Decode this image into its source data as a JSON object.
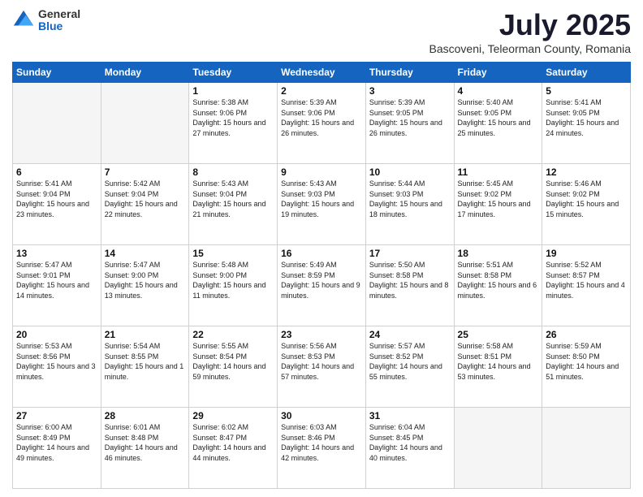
{
  "logo": {
    "general": "General",
    "blue": "Blue"
  },
  "title": "July 2025",
  "subtitle": "Bascoveni, Teleorman County, Romania",
  "weekdays": [
    "Sunday",
    "Monday",
    "Tuesday",
    "Wednesday",
    "Thursday",
    "Friday",
    "Saturday"
  ],
  "weeks": [
    [
      {
        "day": "",
        "sunrise": "",
        "sunset": "",
        "daylight": ""
      },
      {
        "day": "",
        "sunrise": "",
        "sunset": "",
        "daylight": ""
      },
      {
        "day": "1",
        "sunrise": "Sunrise: 5:38 AM",
        "sunset": "Sunset: 9:06 PM",
        "daylight": "Daylight: 15 hours and 27 minutes."
      },
      {
        "day": "2",
        "sunrise": "Sunrise: 5:39 AM",
        "sunset": "Sunset: 9:06 PM",
        "daylight": "Daylight: 15 hours and 26 minutes."
      },
      {
        "day": "3",
        "sunrise": "Sunrise: 5:39 AM",
        "sunset": "Sunset: 9:05 PM",
        "daylight": "Daylight: 15 hours and 26 minutes."
      },
      {
        "day": "4",
        "sunrise": "Sunrise: 5:40 AM",
        "sunset": "Sunset: 9:05 PM",
        "daylight": "Daylight: 15 hours and 25 minutes."
      },
      {
        "day": "5",
        "sunrise": "Sunrise: 5:41 AM",
        "sunset": "Sunset: 9:05 PM",
        "daylight": "Daylight: 15 hours and 24 minutes."
      }
    ],
    [
      {
        "day": "6",
        "sunrise": "Sunrise: 5:41 AM",
        "sunset": "Sunset: 9:04 PM",
        "daylight": "Daylight: 15 hours and 23 minutes."
      },
      {
        "day": "7",
        "sunrise": "Sunrise: 5:42 AM",
        "sunset": "Sunset: 9:04 PM",
        "daylight": "Daylight: 15 hours and 22 minutes."
      },
      {
        "day": "8",
        "sunrise": "Sunrise: 5:43 AM",
        "sunset": "Sunset: 9:04 PM",
        "daylight": "Daylight: 15 hours and 21 minutes."
      },
      {
        "day": "9",
        "sunrise": "Sunrise: 5:43 AM",
        "sunset": "Sunset: 9:03 PM",
        "daylight": "Daylight: 15 hours and 19 minutes."
      },
      {
        "day": "10",
        "sunrise": "Sunrise: 5:44 AM",
        "sunset": "Sunset: 9:03 PM",
        "daylight": "Daylight: 15 hours and 18 minutes."
      },
      {
        "day": "11",
        "sunrise": "Sunrise: 5:45 AM",
        "sunset": "Sunset: 9:02 PM",
        "daylight": "Daylight: 15 hours and 17 minutes."
      },
      {
        "day": "12",
        "sunrise": "Sunrise: 5:46 AM",
        "sunset": "Sunset: 9:02 PM",
        "daylight": "Daylight: 15 hours and 15 minutes."
      }
    ],
    [
      {
        "day": "13",
        "sunrise": "Sunrise: 5:47 AM",
        "sunset": "Sunset: 9:01 PM",
        "daylight": "Daylight: 15 hours and 14 minutes."
      },
      {
        "day": "14",
        "sunrise": "Sunrise: 5:47 AM",
        "sunset": "Sunset: 9:00 PM",
        "daylight": "Daylight: 15 hours and 13 minutes."
      },
      {
        "day": "15",
        "sunrise": "Sunrise: 5:48 AM",
        "sunset": "Sunset: 9:00 PM",
        "daylight": "Daylight: 15 hours and 11 minutes."
      },
      {
        "day": "16",
        "sunrise": "Sunrise: 5:49 AM",
        "sunset": "Sunset: 8:59 PM",
        "daylight": "Daylight: 15 hours and 9 minutes."
      },
      {
        "day": "17",
        "sunrise": "Sunrise: 5:50 AM",
        "sunset": "Sunset: 8:58 PM",
        "daylight": "Daylight: 15 hours and 8 minutes."
      },
      {
        "day": "18",
        "sunrise": "Sunrise: 5:51 AM",
        "sunset": "Sunset: 8:58 PM",
        "daylight": "Daylight: 15 hours and 6 minutes."
      },
      {
        "day": "19",
        "sunrise": "Sunrise: 5:52 AM",
        "sunset": "Sunset: 8:57 PM",
        "daylight": "Daylight: 15 hours and 4 minutes."
      }
    ],
    [
      {
        "day": "20",
        "sunrise": "Sunrise: 5:53 AM",
        "sunset": "Sunset: 8:56 PM",
        "daylight": "Daylight: 15 hours and 3 minutes."
      },
      {
        "day": "21",
        "sunrise": "Sunrise: 5:54 AM",
        "sunset": "Sunset: 8:55 PM",
        "daylight": "Daylight: 15 hours and 1 minute."
      },
      {
        "day": "22",
        "sunrise": "Sunrise: 5:55 AM",
        "sunset": "Sunset: 8:54 PM",
        "daylight": "Daylight: 14 hours and 59 minutes."
      },
      {
        "day": "23",
        "sunrise": "Sunrise: 5:56 AM",
        "sunset": "Sunset: 8:53 PM",
        "daylight": "Daylight: 14 hours and 57 minutes."
      },
      {
        "day": "24",
        "sunrise": "Sunrise: 5:57 AM",
        "sunset": "Sunset: 8:52 PM",
        "daylight": "Daylight: 14 hours and 55 minutes."
      },
      {
        "day": "25",
        "sunrise": "Sunrise: 5:58 AM",
        "sunset": "Sunset: 8:51 PM",
        "daylight": "Daylight: 14 hours and 53 minutes."
      },
      {
        "day": "26",
        "sunrise": "Sunrise: 5:59 AM",
        "sunset": "Sunset: 8:50 PM",
        "daylight": "Daylight: 14 hours and 51 minutes."
      }
    ],
    [
      {
        "day": "27",
        "sunrise": "Sunrise: 6:00 AM",
        "sunset": "Sunset: 8:49 PM",
        "daylight": "Daylight: 14 hours and 49 minutes."
      },
      {
        "day": "28",
        "sunrise": "Sunrise: 6:01 AM",
        "sunset": "Sunset: 8:48 PM",
        "daylight": "Daylight: 14 hours and 46 minutes."
      },
      {
        "day": "29",
        "sunrise": "Sunrise: 6:02 AM",
        "sunset": "Sunset: 8:47 PM",
        "daylight": "Daylight: 14 hours and 44 minutes."
      },
      {
        "day": "30",
        "sunrise": "Sunrise: 6:03 AM",
        "sunset": "Sunset: 8:46 PM",
        "daylight": "Daylight: 14 hours and 42 minutes."
      },
      {
        "day": "31",
        "sunrise": "Sunrise: 6:04 AM",
        "sunset": "Sunset: 8:45 PM",
        "daylight": "Daylight: 14 hours and 40 minutes."
      },
      {
        "day": "",
        "sunrise": "",
        "sunset": "",
        "daylight": ""
      },
      {
        "day": "",
        "sunrise": "",
        "sunset": "",
        "daylight": ""
      }
    ]
  ]
}
